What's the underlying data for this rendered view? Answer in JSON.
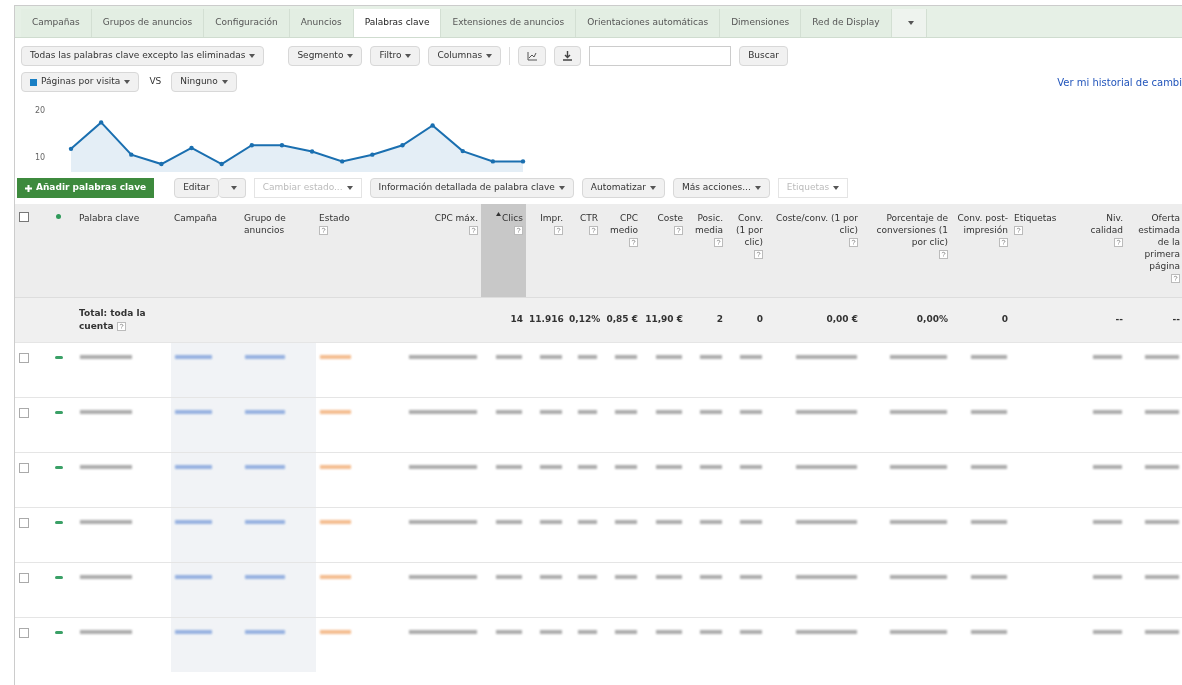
{
  "tabs": [
    {
      "label": "Campañas",
      "selected": false
    },
    {
      "label": "Grupos de anuncios",
      "selected": false
    },
    {
      "label": "Configuración",
      "selected": false
    },
    {
      "label": "Anuncios",
      "selected": false
    },
    {
      "label": "Palabras clave",
      "selected": true
    },
    {
      "label": "Extensiones de anuncios",
      "selected": false
    },
    {
      "label": "Orientaciones automáticas",
      "selected": false
    },
    {
      "label": "Dimensiones",
      "selected": false
    },
    {
      "label": "Red de Display",
      "selected": false
    }
  ],
  "toolbar": {
    "filter": "Todas las palabras clave excepto las eliminadas",
    "menus": [
      "Segmento",
      "Filtro",
      "Columnas"
    ],
    "search_button": "Buscar"
  },
  "metrics": {
    "primary": {
      "label": "Páginas por visita",
      "color": "#1a7fc4"
    },
    "vs": "VS",
    "secondary": "Ninguno",
    "history_link": "Ver mi historial de cambi"
  },
  "sparkline": {
    "y_labels": [
      "20",
      "10"
    ]
  },
  "actions": [
    {
      "label": "Añadir palabras clave",
      "kind": "primary",
      "disabled": false
    },
    {
      "label": "Editar",
      "kind": "split",
      "disabled": false
    },
    {
      "label": "Cambiar estado...",
      "kind": "menu",
      "disabled": true
    },
    {
      "label": "Información detallada de palabra clave",
      "kind": "menu",
      "disabled": false
    },
    {
      "label": "Automatizar",
      "kind": "menu",
      "disabled": false
    },
    {
      "label": "Más acciones...",
      "kind": "menu",
      "disabled": false
    },
    {
      "label": "Etiquetas",
      "kind": "menu",
      "disabled": true
    }
  ],
  "table": {
    "select_all": {
      "checked": false
    },
    "columns": [
      {
        "label": "Palabra clave",
        "help": false,
        "numeric": false,
        "sorted": false,
        "total": "Total: toda la cuenta",
        "total_help": true
      },
      {
        "label": "Campaña",
        "help": false,
        "numeric": false,
        "sorted": false
      },
      {
        "label": "Grupo de anuncios",
        "help": false,
        "numeric": false,
        "sorted": false
      },
      {
        "label": "Estado",
        "help": true,
        "numeric": false,
        "sorted": false
      },
      {
        "label": "CPC máx.",
        "help": true,
        "numeric": true,
        "sorted": false
      },
      {
        "label": "Clics",
        "help": true,
        "numeric": true,
        "sorted": true,
        "total": "14"
      },
      {
        "label": "Impr.",
        "help": true,
        "numeric": true,
        "sorted": false,
        "total": "11.916"
      },
      {
        "label": "CTR",
        "help": true,
        "numeric": true,
        "sorted": false,
        "total": "0,12%"
      },
      {
        "label": "CPC medio",
        "help": true,
        "numeric": true,
        "sorted": false,
        "total": "0,85 €"
      },
      {
        "label": "Coste",
        "help": true,
        "numeric": true,
        "sorted": false,
        "total": "11,90 €"
      },
      {
        "label": "Posic. media",
        "help": true,
        "numeric": true,
        "sorted": false,
        "total": "2"
      },
      {
        "label": "Conv. (1 por clic)",
        "help": true,
        "numeric": true,
        "sorted": false,
        "total": "0"
      },
      {
        "label": "Coste/conv. (1 por clic)",
        "help": true,
        "numeric": true,
        "sorted": false,
        "total": "0,00 €"
      },
      {
        "label": "Porcentaje de conversiones (1 por clic)",
        "help": true,
        "numeric": true,
        "sorted": false,
        "total": "0,00%"
      },
      {
        "label": "Conv. post-impresión",
        "help": true,
        "numeric": true,
        "sorted": false,
        "total": "0"
      },
      {
        "label": "Etiquetas",
        "help": true,
        "numeric": false,
        "sorted": false
      },
      {
        "label": "Niv. calidad",
        "help": true,
        "numeric": true,
        "sorted": false,
        "total": "--"
      },
      {
        "label": "Oferta estimada de la primera página",
        "help": true,
        "numeric": true,
        "sorted": false,
        "total": "--"
      }
    ],
    "rows": [
      {
        "checked": false
      },
      {
        "checked": false
      },
      {
        "checked": false
      },
      {
        "checked": false
      },
      {
        "checked": false
      },
      {
        "checked": false
      }
    ]
  }
}
